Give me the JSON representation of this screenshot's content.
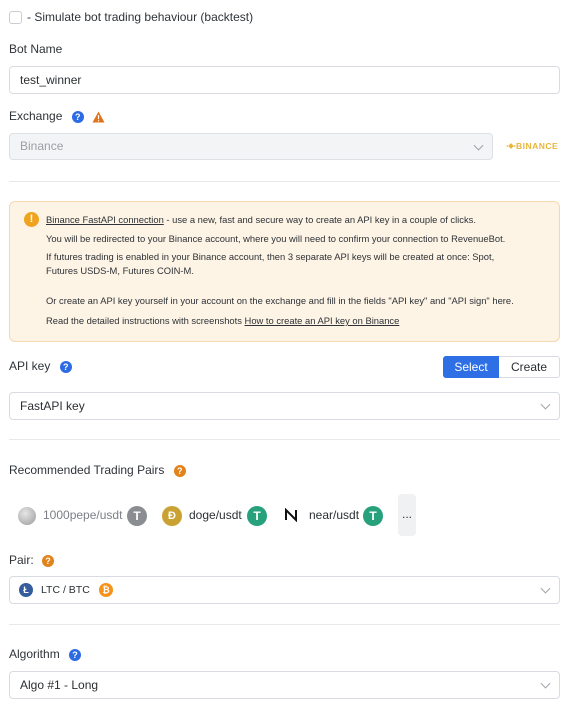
{
  "simulate": {
    "label": " - Simulate bot trading behaviour (backtest)"
  },
  "bot_name": {
    "label": "Bot Name",
    "value": "test_winner"
  },
  "exchange": {
    "label": "Exchange",
    "value": "Binance",
    "logo_text": "BINANCE",
    "logo_color": "#e8b53b"
  },
  "notice": {
    "link": "Binance FastAPI connection",
    "line1_rest": " - use a new, fast and secure way to create an API key in a couple of clicks.",
    "line2": "You will be redirected to your Binance account, where you will need to confirm your connection to RevenueBot.",
    "line3": "If futures trading is enabled in your Binance account, then 3 separate API keys will be created at once: Spot,",
    "line4": "Futures USDS-M, Futures COIN-M.",
    "line5": "Or create an API key yourself in your account on the exchange and fill in the fields \"API key\" and \"API sign\" here.",
    "line6_pre": "Read the detailed instructions with screenshots ",
    "line6_link": "How to create an API key on Binance",
    "icon": "!"
  },
  "api_key": {
    "label": "API key",
    "select_btn": "Select",
    "create_btn": "Create",
    "value": "FastAPI key"
  },
  "recommended": {
    "label": "Recommended Trading Pairs",
    "pairs": [
      {
        "name": "1000pepe/usdt",
        "quote_icon": "T"
      },
      {
        "name": "doge/usdt",
        "quote_icon": "T"
      },
      {
        "name": "near/usdt",
        "quote_icon": "T"
      }
    ],
    "more": "..."
  },
  "pair": {
    "label": "Pair:",
    "value": "LTC / BTC",
    "base_icon": "Ł",
    "quote_icon": "₿"
  },
  "algorithm": {
    "label": "Algorithm",
    "value": "Algo #1 - Long"
  },
  "colors": {
    "accent": "#2f6fe6",
    "tether": "#26a17b",
    "warning": "#f0a31f",
    "gray_tether": "#8a8d91"
  }
}
